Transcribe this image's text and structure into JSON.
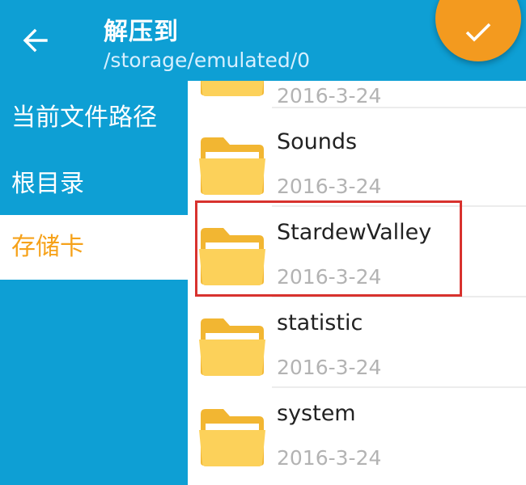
{
  "header": {
    "back_icon": "arrow-left-icon",
    "title": "解压到",
    "path": "/storage/emulated/0",
    "confirm_icon": "check-icon",
    "accent_color": "#f39a1f",
    "bar_color": "#0e9fd4"
  },
  "sidebar": {
    "items": [
      {
        "label": "当前文件路径"
      },
      {
        "label": "根目录"
      },
      {
        "label": "存储卡"
      }
    ],
    "active_color": "#f6a21a"
  },
  "files": [
    {
      "name": "",
      "date": "2016-3-24"
    },
    {
      "name": "Sounds",
      "date": "2016-3-24"
    },
    {
      "name": "StardewValley",
      "date": "2016-3-24"
    },
    {
      "name": "statistic",
      "date": "2016-3-24"
    },
    {
      "name": "system",
      "date": "2016-3-24"
    }
  ],
  "folder_icon": "folder-icon",
  "highlight_color": "#d8322e"
}
